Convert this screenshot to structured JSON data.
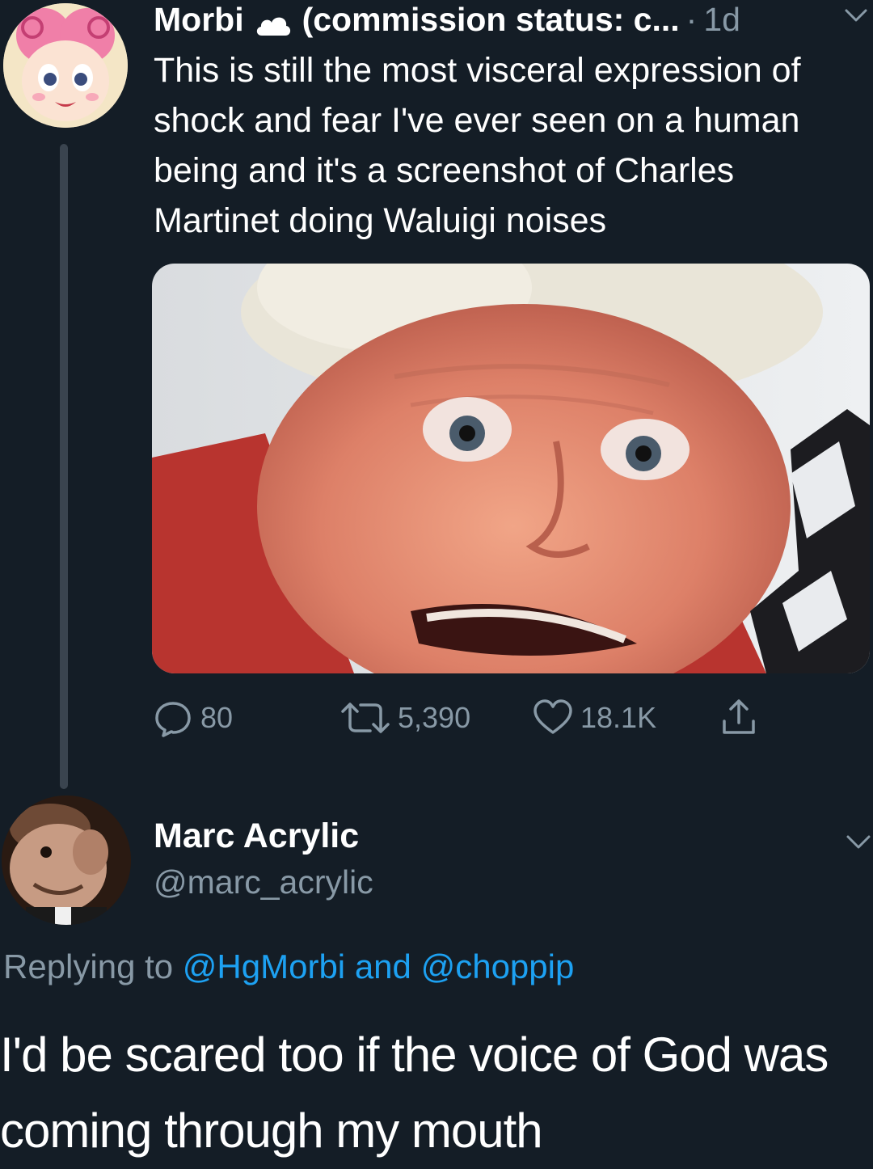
{
  "tweet": {
    "display_name": "Morbi",
    "badge_icon": "cloud-icon",
    "status": "(commission status: c...",
    "separator": "·",
    "time": "1d",
    "text": "This is still the most visceral expression of shock and fear I've ever seen on a human being and it's a screenshot of Charles Martinet doing Waluigi noises",
    "actions": {
      "reply_count": "80",
      "retweet_count": "5,390",
      "like_count": "18.1K"
    }
  },
  "reply": {
    "display_name": "Marc Acrylic",
    "handle": "@marc_acrylic",
    "replying_prefix": "Replying to",
    "mention_1": "@HgMorbi",
    "conjunction": "and",
    "mention_2": "@choppip",
    "text": "I'd be scared too if the voice of God was coming through my mouth"
  },
  "colors": {
    "background": "#141d26",
    "muted": "#8899a6",
    "link": "#1da1f2",
    "thread_line": "#3a444f"
  }
}
